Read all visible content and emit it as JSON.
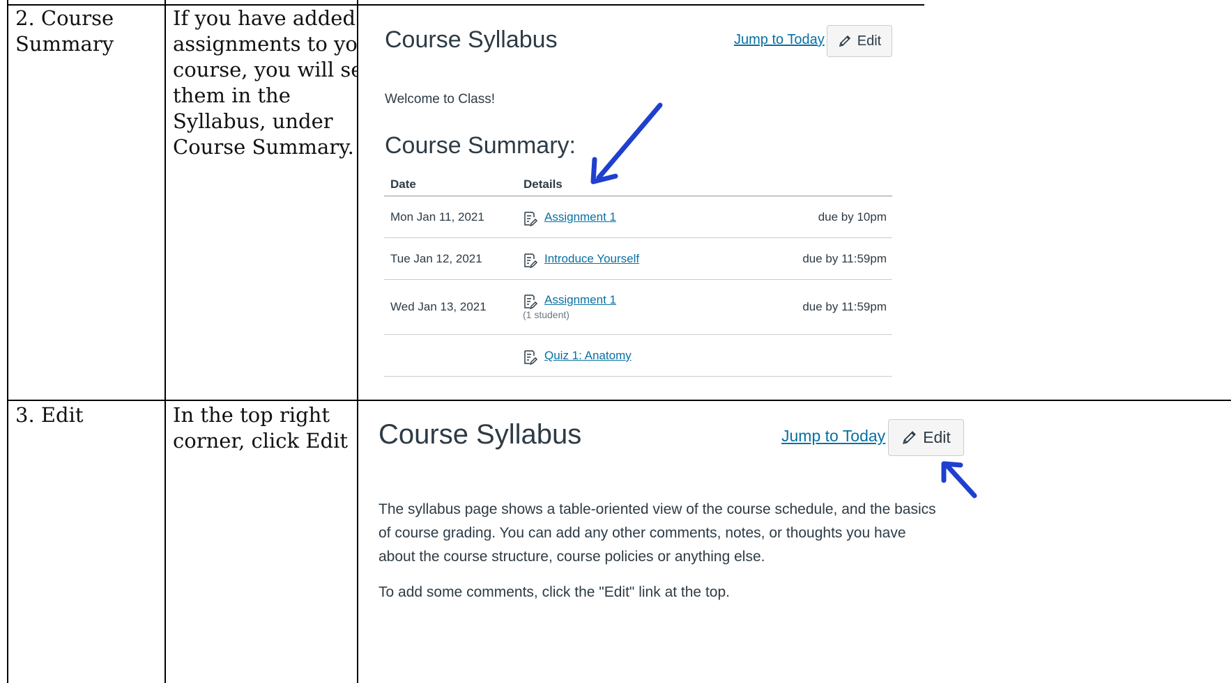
{
  "rows": [
    {
      "step": "2. Course\nSummary",
      "description": "If you have added\nassignments to your\ncourse, you will see\nthem in the\nSyllabus, under\nCourse Summary.",
      "screenshot": {
        "title": "Course Syllabus",
        "jump_link": "Jump to Today",
        "edit_label": "Edit",
        "welcome": "Welcome to Class!",
        "summary_heading": "Course Summary:",
        "columns": [
          "Date",
          "Details"
        ],
        "items": [
          {
            "date": "Mon Jan 11, 2021",
            "name": "Assignment 1",
            "sub": "",
            "due": "due by 10pm"
          },
          {
            "date": "Tue Jan 12, 2021",
            "name": "Introduce Yourself",
            "sub": "",
            "due": "due by 11:59pm"
          },
          {
            "date": "Wed Jan 13, 2021",
            "name": "Assignment 1",
            "sub": "(1 student)",
            "due": "due by 11:59pm"
          },
          {
            "date": "",
            "name": "Quiz 1: Anatomy",
            "sub": "",
            "due": ""
          }
        ]
      }
    },
    {
      "step": "3. Edit",
      "description": "In the top right\ncorner, click Edit",
      "screenshot": {
        "title": "Course Syllabus",
        "jump_link": "Jump to Today",
        "edit_label": "Edit",
        "body_lines": [
          "The syllabus page shows a table-oriented view of the course schedule, and the basics",
          "of course grading. You can add any other comments, notes, or thoughts you have",
          "about the course structure, course policies or anything else."
        ],
        "body_line2": "To add some comments, click the \"Edit\" link at the top."
      }
    }
  ],
  "colors": {
    "link": "#0770a3",
    "arrow": "#1f3fcf",
    "text": "#2d3b45"
  }
}
